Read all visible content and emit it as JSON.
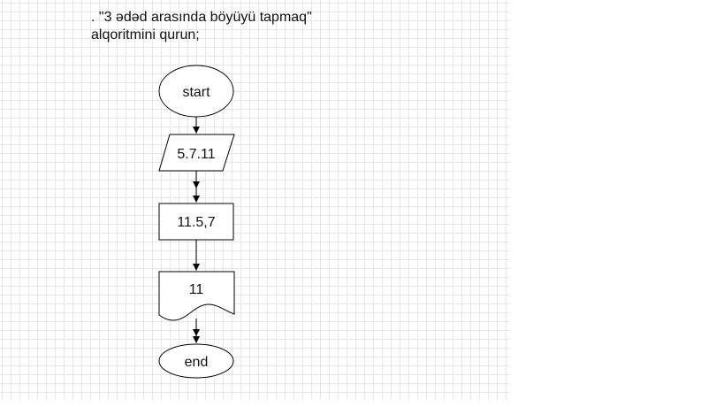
{
  "task": {
    "line1": ". \"3 ədəd arasında böyüyü tapmaq\"",
    "line2": "alqoritmini qurun;"
  },
  "flowchart": {
    "start_label": "start",
    "input_label": "5.7.11",
    "process_label": "11.5,7",
    "output_label": "11",
    "end_label": "end"
  },
  "colors": {
    "stroke": "#000000",
    "grid": "#e6e6e6",
    "background": "#ffffff"
  }
}
